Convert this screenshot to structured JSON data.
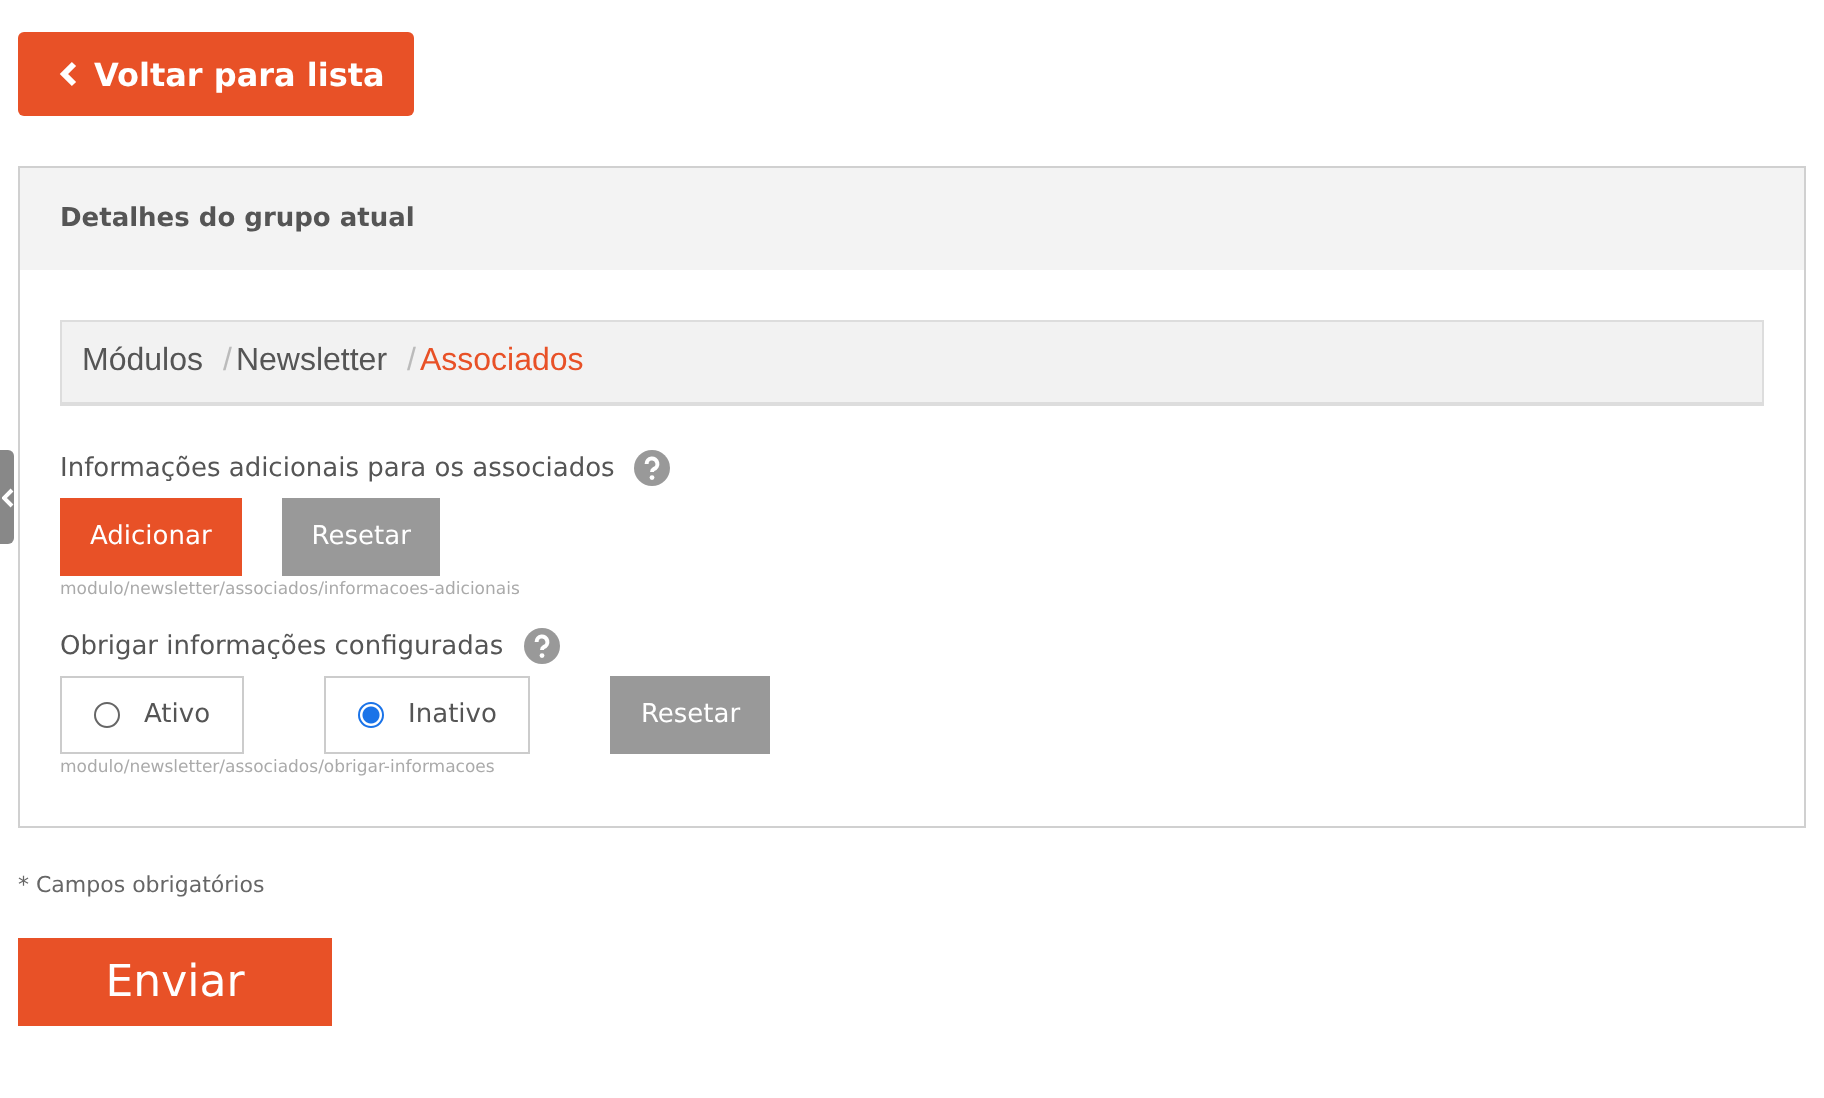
{
  "back_button": {
    "label": "Voltar para lista"
  },
  "panel": {
    "title": "Detalhes do grupo atual"
  },
  "breadcrumb": [
    {
      "label": "Módulos",
      "selected": false
    },
    {
      "separator": "/",
      "label": "Newsletter",
      "selected": false
    },
    {
      "separator": "/",
      "label": "Associados",
      "selected": true
    }
  ],
  "fields": [
    {
      "kind": "buttons",
      "label": "Informações adicionais para os associados",
      "buttons": [
        {
          "label": "Adicionar",
          "kind": "primary"
        },
        {
          "label": "Resetar",
          "kind": "secondary"
        }
      ],
      "path": "modulo/newsletter/associados/informacoes-adicionais"
    },
    {
      "kind": "radios",
      "label": "Obrigar informações configuradas",
      "options": [
        {
          "label": "Ativo",
          "selected": false
        },
        {
          "label": "Inativo",
          "selected": true
        }
      ],
      "buttons": [
        {
          "label": "Resetar",
          "kind": "secondary"
        }
      ],
      "path": "modulo/newsletter/associados/obrigar-informacoes"
    }
  ],
  "required_note": "* Campos obrigatórios",
  "submit_button": {
    "label": "Enviar"
  }
}
